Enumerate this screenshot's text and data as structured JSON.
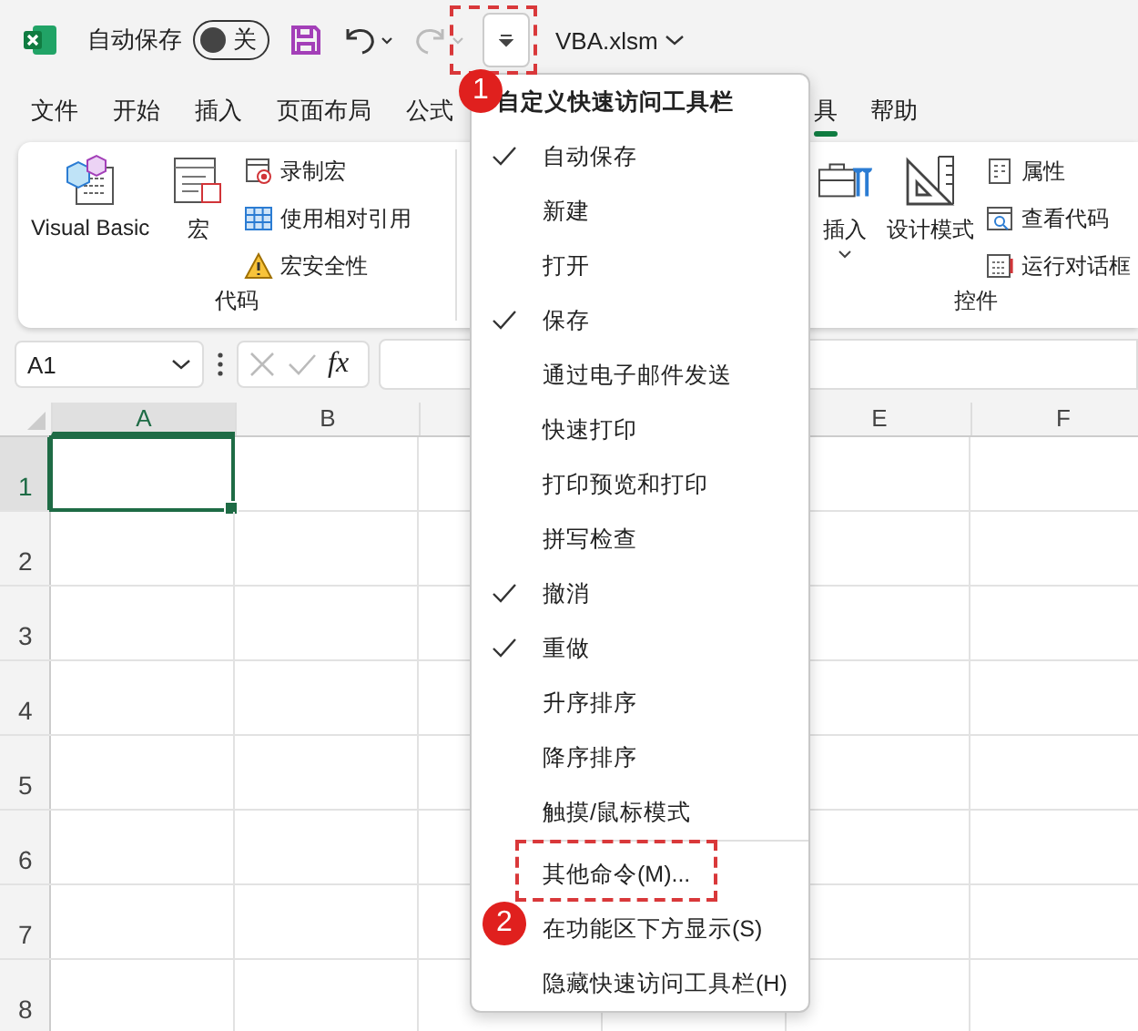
{
  "title_bar": {
    "autosave": {
      "label": "自动保存",
      "on": false,
      "state_text": "关"
    },
    "undo": {
      "disabled": false
    },
    "redo": {
      "disabled": true
    },
    "file_name": "VBA.xlsm"
  },
  "ribbon_tabs_left": [
    {
      "label": "文件",
      "selected": false
    },
    {
      "label": "开始",
      "selected": false
    },
    {
      "label": "插入",
      "selected": false
    },
    {
      "label": "页面布局",
      "selected": false
    },
    {
      "label": "公式",
      "selected": false
    }
  ],
  "ribbon_tabs_right": [
    {
      "label": "具",
      "selected": true
    },
    {
      "label": "帮助",
      "selected": false
    }
  ],
  "ribbon_groups": [
    {
      "label": "代码",
      "large_buttons": [
        {
          "label": "Visual Basic"
        },
        {
          "label": "宏"
        }
      ],
      "small_buttons": [
        {
          "label": "录制宏"
        },
        {
          "label": "使用相对引用"
        },
        {
          "label": "宏安全性"
        }
      ]
    },
    {
      "label": "控件",
      "large_buttons": [
        {
          "label": "插入"
        },
        {
          "label": "设计模式"
        }
      ],
      "small_buttons": [
        {
          "label": "属性"
        },
        {
          "label": "查看代码"
        },
        {
          "label": "运行对话框"
        }
      ]
    }
  ],
  "formula_bar": {
    "name_box": "A1",
    "function_label": "fx"
  },
  "grid": {
    "columns_left": [
      {
        "label": "A",
        "selected": true
      },
      {
        "label": "B",
        "selected": false
      }
    ],
    "columns_right": [
      {
        "label": "E",
        "selected": false
      },
      {
        "label": "F",
        "selected": false
      }
    ],
    "rows": [
      {
        "label": "1",
        "selected": true
      },
      {
        "label": "2",
        "selected": false
      },
      {
        "label": "3",
        "selected": false
      },
      {
        "label": "4",
        "selected": false
      },
      {
        "label": "5",
        "selected": false
      },
      {
        "label": "6",
        "selected": false
      },
      {
        "label": "7",
        "selected": false
      },
      {
        "label": "8",
        "selected": false
      }
    ]
  },
  "menu": {
    "title": "自定义快速访问工具栏",
    "items": [
      {
        "label": "自动保存",
        "checked": true
      },
      {
        "label": "新建",
        "checked": false
      },
      {
        "label": "打开",
        "checked": false
      },
      {
        "label": "保存",
        "checked": true
      },
      {
        "label": "通过电子邮件发送",
        "checked": false
      },
      {
        "label": "快速打印",
        "checked": false
      },
      {
        "label": "打印预览和打印",
        "checked": false
      },
      {
        "label": "拼写检查",
        "checked": false
      },
      {
        "label": "撤消",
        "checked": true
      },
      {
        "label": "重做",
        "checked": true
      },
      {
        "label": "升序排序",
        "checked": false
      },
      {
        "label": "降序排序",
        "checked": false
      },
      {
        "label": "触摸/鼠标模式",
        "checked": false
      }
    ],
    "commands": [
      {
        "label": "其他命令(M)..."
      },
      {
        "label": "在功能区下方显示(S)"
      },
      {
        "label": "隐藏快速访问工具栏(H)"
      }
    ]
  },
  "callouts": [
    {
      "number": "1"
    },
    {
      "number": "2"
    }
  ]
}
